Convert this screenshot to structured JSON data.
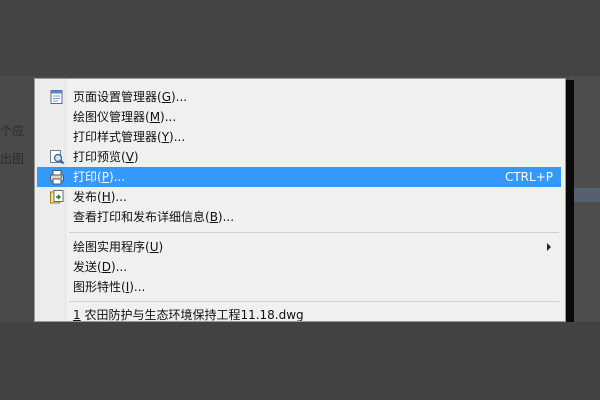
{
  "background": {
    "fragments": [
      "个应",
      "出图"
    ]
  },
  "menu": {
    "items": [
      {
        "label_pre": "页面设置管理器(",
        "key": "G",
        "label_post": ")...",
        "icon": "page-setup-icon",
        "shortcut": "",
        "submenu": false,
        "active": false
      },
      {
        "label_pre": "绘图仪管理器(",
        "key": "M",
        "label_post": ")...",
        "icon": "",
        "shortcut": "",
        "submenu": false,
        "active": false
      },
      {
        "label_pre": "打印样式管理器(",
        "key": "Y",
        "label_post": ")...",
        "icon": "",
        "shortcut": "",
        "submenu": false,
        "active": false
      },
      {
        "label_pre": "打印预览(",
        "key": "V",
        "label_post": ")",
        "icon": "print-preview-icon",
        "shortcut": "",
        "submenu": false,
        "active": false
      },
      {
        "label_pre": "打印(",
        "key": "P",
        "label_post": ")...",
        "icon": "printer-icon",
        "shortcut": "CTRL+P",
        "submenu": false,
        "active": true
      },
      {
        "label_pre": "发布(",
        "key": "H",
        "label_post": ")...",
        "icon": "publish-icon",
        "shortcut": "",
        "submenu": false,
        "active": false
      },
      {
        "label_pre": "查看打印和发布详细信息(",
        "key": "B",
        "label_post": ")...",
        "icon": "",
        "shortcut": "",
        "submenu": false,
        "active": false
      },
      {
        "label_pre": "绘图实用程序(",
        "key": "U",
        "label_post": ")",
        "icon": "",
        "shortcut": "",
        "submenu": true,
        "active": false
      },
      {
        "label_pre": "发送(",
        "key": "D",
        "label_post": ")...",
        "icon": "",
        "shortcut": "",
        "submenu": false,
        "active": false
      },
      {
        "label_pre": "图形特性(",
        "key": "I",
        "label_post": ")...",
        "icon": "",
        "shortcut": "",
        "submenu": false,
        "active": false
      },
      {
        "label_pre": "",
        "key": "1",
        "label_post": " 农田防护与生态环境保持工程11.18.dwg",
        "icon": "",
        "shortcut": "",
        "submenu": false,
        "active": false
      }
    ],
    "colors": {
      "highlight": "#3399ff",
      "background": "#f0f0f0"
    }
  }
}
